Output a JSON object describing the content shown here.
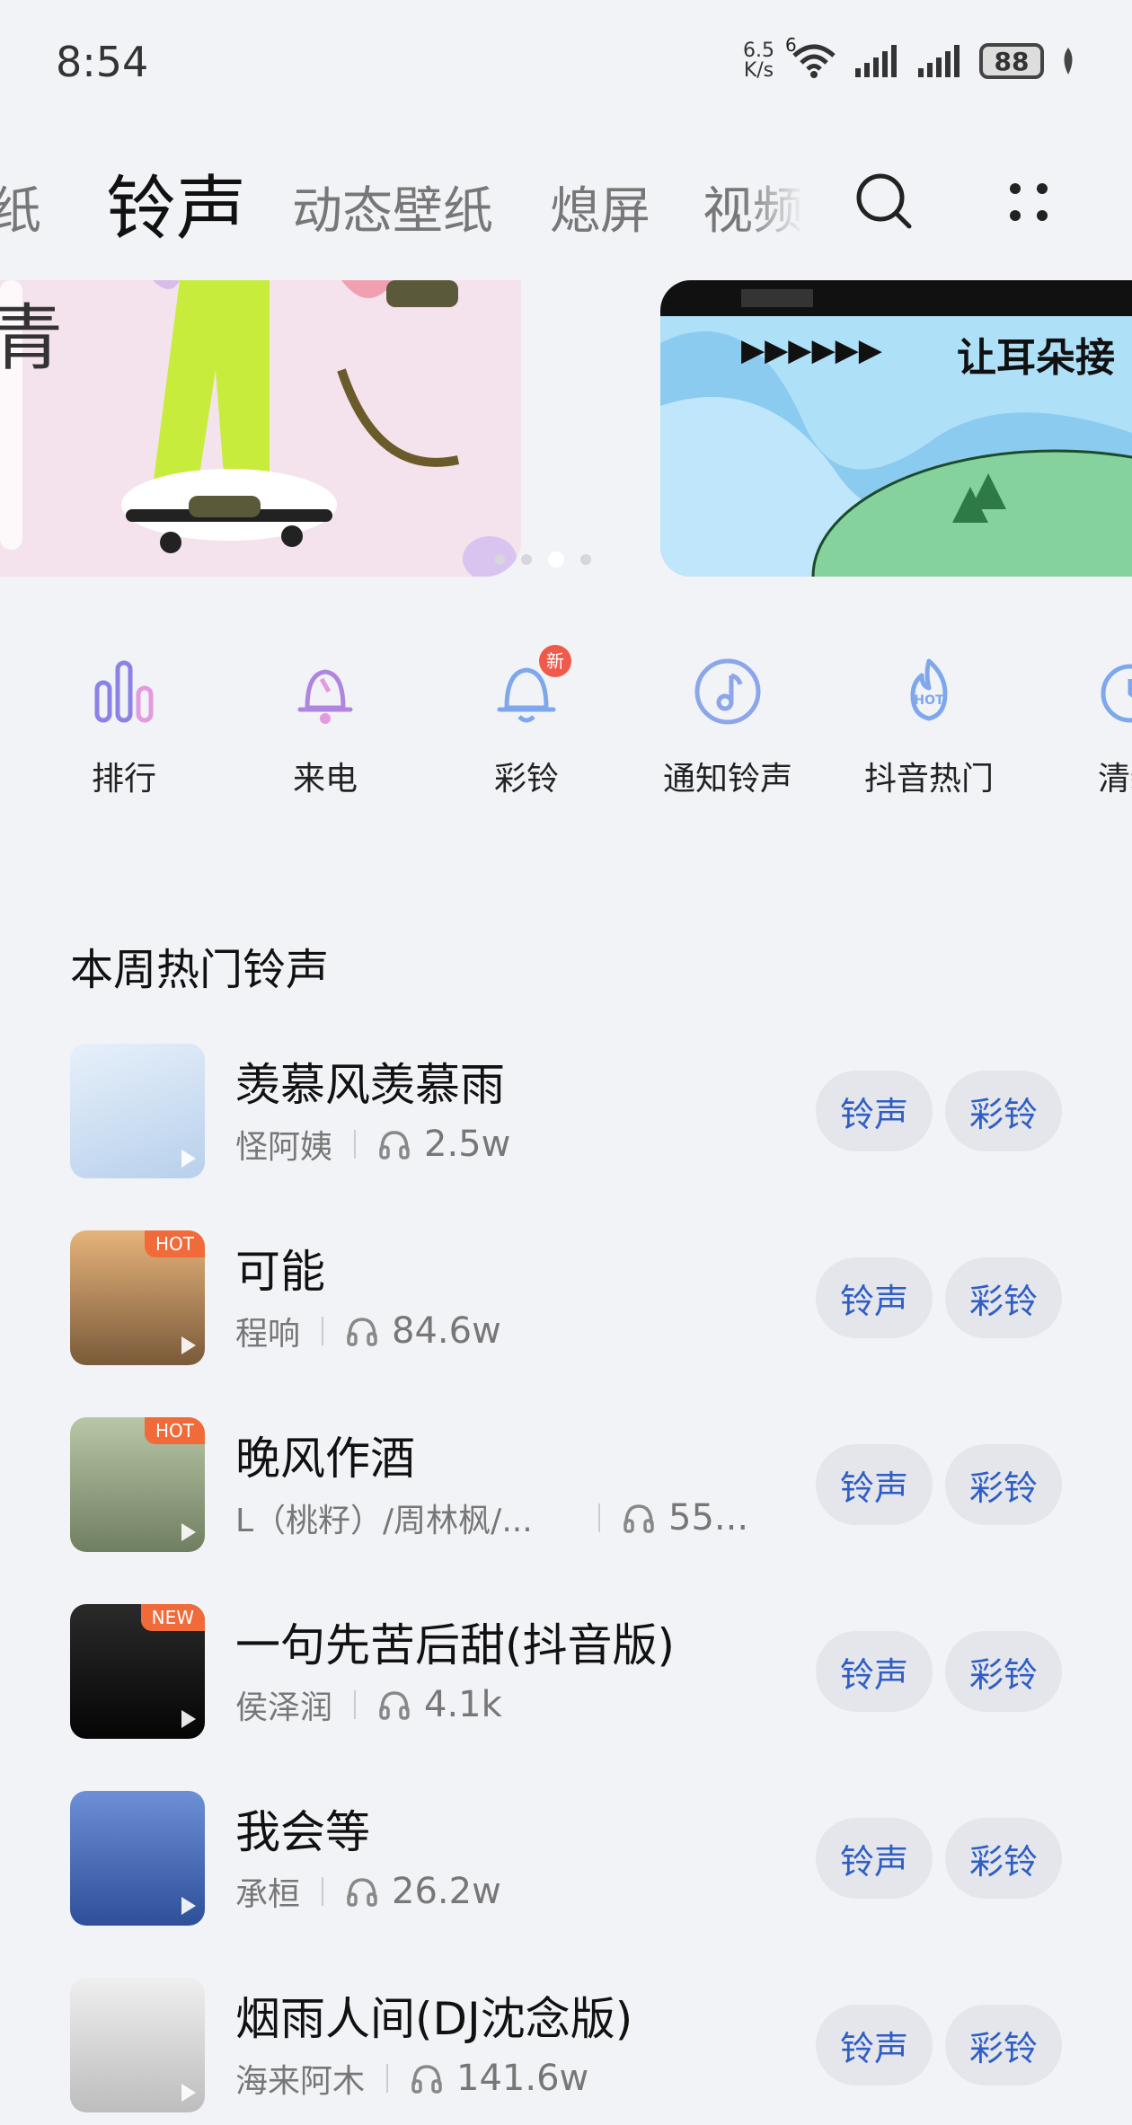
{
  "status_bar": {
    "time": "8:54",
    "net_speed_value": "6.5",
    "net_speed_unit": "K/s",
    "wifi_label": "6",
    "battery": "88"
  },
  "tabs": [
    {
      "label": "纸",
      "active": false
    },
    {
      "label": "铃声",
      "active": true
    },
    {
      "label": "动态壁纸",
      "active": false
    },
    {
      "label": "熄屏",
      "active": false
    },
    {
      "label": "视频",
      "active": false
    }
  ],
  "banner": {
    "left_text": "青",
    "right_text": "让耳朵接"
  },
  "categories": [
    {
      "label": "排行",
      "icon": "bar-chart-icon"
    },
    {
      "label": "来电",
      "icon": "bell-call-icon"
    },
    {
      "label": "彩铃",
      "icon": "bell-icon",
      "badge": "新"
    },
    {
      "label": "通知铃声",
      "icon": "music-note-icon"
    },
    {
      "label": "抖音热门",
      "icon": "hot-flame-icon",
      "icon_text": "HOT"
    },
    {
      "label": "清新",
      "icon": "clock-icon"
    }
  ],
  "section_title": "本周热门铃声",
  "actions": {
    "ringtone": "铃声",
    "color_ring": "彩铃"
  },
  "songs": [
    {
      "title": "羡慕风羡慕雨",
      "artist": "怪阿姨",
      "plays": "2.5w",
      "badge": "",
      "cover_color": "#cfe1f3"
    },
    {
      "title": "可能",
      "artist": "程响",
      "plays": "84.6w",
      "badge": "HOT",
      "cover_color": "#c48a4a"
    },
    {
      "title": "晚风作酒",
      "artist": "L（桃籽）/周林枫/...",
      "plays": "55...",
      "badge": "HOT",
      "cover_color": "#8aa07a"
    },
    {
      "title": "一句先苦后甜(抖音版)",
      "artist": "侯泽润",
      "plays": "4.1k",
      "badge": "NEW",
      "cover_color": "#111111"
    },
    {
      "title": "我会等",
      "artist": "承桓",
      "plays": "26.2w",
      "badge": "",
      "cover_color": "#3a5fb0"
    },
    {
      "title": "烟雨人间(DJ沈念版)",
      "artist": "海来阿木",
      "plays": "141.6w",
      "badge": "",
      "cover_color": "#d9d9d9"
    }
  ]
}
